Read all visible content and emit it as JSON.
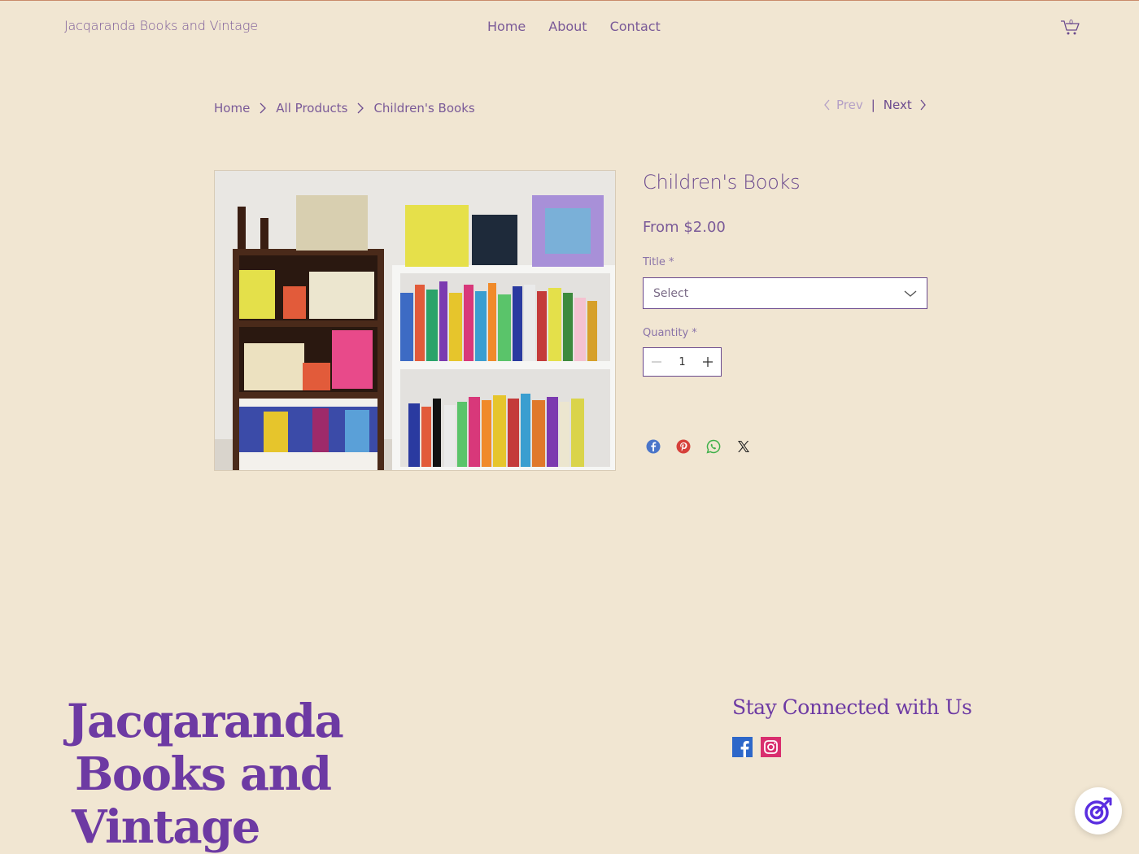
{
  "header": {
    "site_name": "Jacqaranda Books and Vintage",
    "nav": [
      "Home",
      "About",
      "Contact"
    ],
    "cart_count": "0"
  },
  "breadcrumb": {
    "items": [
      "Home",
      "All Products",
      "Children's Books"
    ],
    "prev": "Prev",
    "next": "Next"
  },
  "product": {
    "title": "Children's Books",
    "price": "From $2.00",
    "title_label": "Title *",
    "select_placeholder": "Select",
    "quantity_label": "Quantity *",
    "quantity": "1",
    "share_icons": [
      "facebook-icon",
      "pinterest-icon",
      "whatsapp-icon",
      "x-icon"
    ]
  },
  "footer": {
    "brand_line1": "Jacqaranda",
    "brand_line2": "Books and",
    "brand_line3": "Vintage",
    "stay_connected": "Stay Connected with Us"
  },
  "colors": {
    "background": "#f1e6d2",
    "text_purple": "#6b4a8e",
    "brand_purple": "#6d3aa3"
  }
}
